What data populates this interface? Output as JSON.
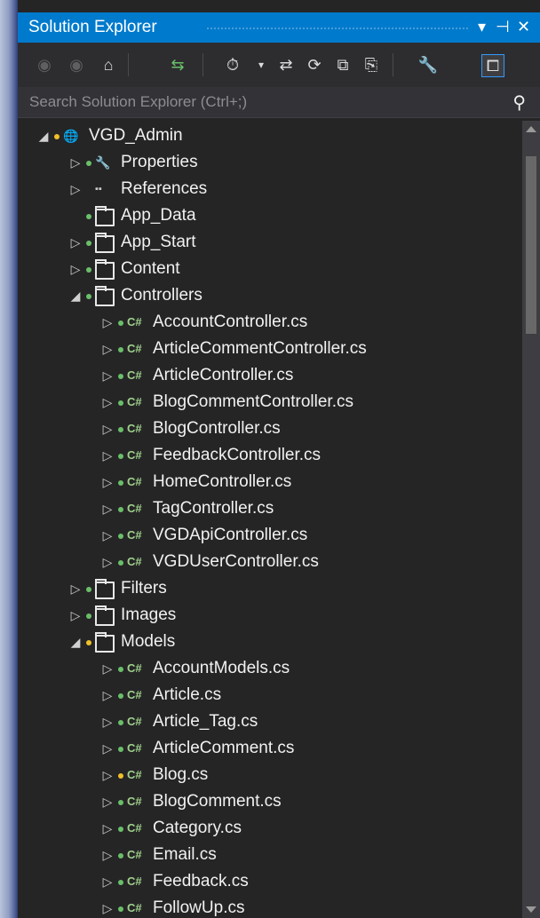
{
  "window": {
    "title": "Solution Explorer",
    "pin_glyph": "▾ ⊣ ✕"
  },
  "toolbar": {
    "icons": [
      "back-icon",
      "forward-icon",
      "home-icon",
      "switch-views-icon",
      "pending-changes-icon",
      "sync-icon",
      "refresh-icon",
      "collapse-all-icon",
      "show-all-files-icon",
      "properties-icon",
      "preview-icon"
    ]
  },
  "search": {
    "placeholder": "Search Solution Explorer (Ctrl+;)"
  },
  "colors": {
    "accent": "#007acc",
    "background": "#252526",
    "dot_green": "#6abf69",
    "dot_yellow": "#f0c028"
  },
  "tree": {
    "items": [
      {
        "label": "VGD_Admin",
        "expander": "◢",
        "dot": "yellow",
        "icon": "project-icon",
        "level": 0
      },
      {
        "label": "Properties",
        "expander": "▷",
        "dot": "green",
        "icon": "wrench-icon",
        "level": 1
      },
      {
        "label": "References",
        "expander": "▷",
        "dot": "none",
        "icon": "references-icon",
        "level": 1
      },
      {
        "label": "App_Data",
        "expander": "",
        "dot": "green",
        "icon": "folder-icon",
        "level": 1
      },
      {
        "label": "App_Start",
        "expander": "▷",
        "dot": "green",
        "icon": "folder-icon",
        "level": 1
      },
      {
        "label": "Content",
        "expander": "▷",
        "dot": "green",
        "icon": "folder-icon",
        "level": 1
      },
      {
        "label": "Controllers",
        "expander": "◢",
        "dot": "green",
        "icon": "folder-icon",
        "level": 1
      },
      {
        "label": "AccountController.cs",
        "expander": "▷",
        "dot": "green",
        "icon": "csharp-icon",
        "level": 2
      },
      {
        "label": "ArticleCommentController.cs",
        "expander": "▷",
        "dot": "green",
        "icon": "csharp-icon",
        "level": 2
      },
      {
        "label": "ArticleController.cs",
        "expander": "▷",
        "dot": "green",
        "icon": "csharp-icon",
        "level": 2
      },
      {
        "label": "BlogCommentController.cs",
        "expander": "▷",
        "dot": "green",
        "icon": "csharp-icon",
        "level": 2
      },
      {
        "label": "BlogController.cs",
        "expander": "▷",
        "dot": "green",
        "icon": "csharp-icon",
        "level": 2
      },
      {
        "label": "FeedbackController.cs",
        "expander": "▷",
        "dot": "green",
        "icon": "csharp-icon",
        "level": 2
      },
      {
        "label": "HomeController.cs",
        "expander": "▷",
        "dot": "green",
        "icon": "csharp-icon",
        "level": 2
      },
      {
        "label": "TagController.cs",
        "expander": "▷",
        "dot": "green",
        "icon": "csharp-icon",
        "level": 2
      },
      {
        "label": "VGDApiController.cs",
        "expander": "▷",
        "dot": "green",
        "icon": "csharp-icon",
        "level": 2
      },
      {
        "label": "VGDUserController.cs",
        "expander": "▷",
        "dot": "green",
        "icon": "csharp-icon",
        "level": 2
      },
      {
        "label": "Filters",
        "expander": "▷",
        "dot": "green",
        "icon": "folder-icon",
        "level": 1
      },
      {
        "label": "Images",
        "expander": "▷",
        "dot": "green",
        "icon": "folder-icon",
        "level": 1
      },
      {
        "label": "Models",
        "expander": "◢",
        "dot": "yellow",
        "icon": "folder-icon",
        "level": 1
      },
      {
        "label": "AccountModels.cs",
        "expander": "▷",
        "dot": "green",
        "icon": "csharp-icon",
        "level": 2
      },
      {
        "label": "Article.cs",
        "expander": "▷",
        "dot": "green",
        "icon": "csharp-icon",
        "level": 2
      },
      {
        "label": "Article_Tag.cs",
        "expander": "▷",
        "dot": "green",
        "icon": "csharp-icon",
        "level": 2
      },
      {
        "label": "ArticleComment.cs",
        "expander": "▷",
        "dot": "green",
        "icon": "csharp-icon",
        "level": 2
      },
      {
        "label": "Blog.cs",
        "expander": "▷",
        "dot": "yellow",
        "icon": "csharp-icon",
        "level": 2
      },
      {
        "label": "BlogComment.cs",
        "expander": "▷",
        "dot": "green",
        "icon": "csharp-icon",
        "level": 2
      },
      {
        "label": "Category.cs",
        "expander": "▷",
        "dot": "green",
        "icon": "csharp-icon",
        "level": 2
      },
      {
        "label": "Email.cs",
        "expander": "▷",
        "dot": "green",
        "icon": "csharp-icon",
        "level": 2
      },
      {
        "label": "Feedback.cs",
        "expander": "▷",
        "dot": "green",
        "icon": "csharp-icon",
        "level": 2
      },
      {
        "label": "FollowUp.cs",
        "expander": "▷",
        "dot": "green",
        "icon": "csharp-icon",
        "level": 2
      }
    ]
  }
}
